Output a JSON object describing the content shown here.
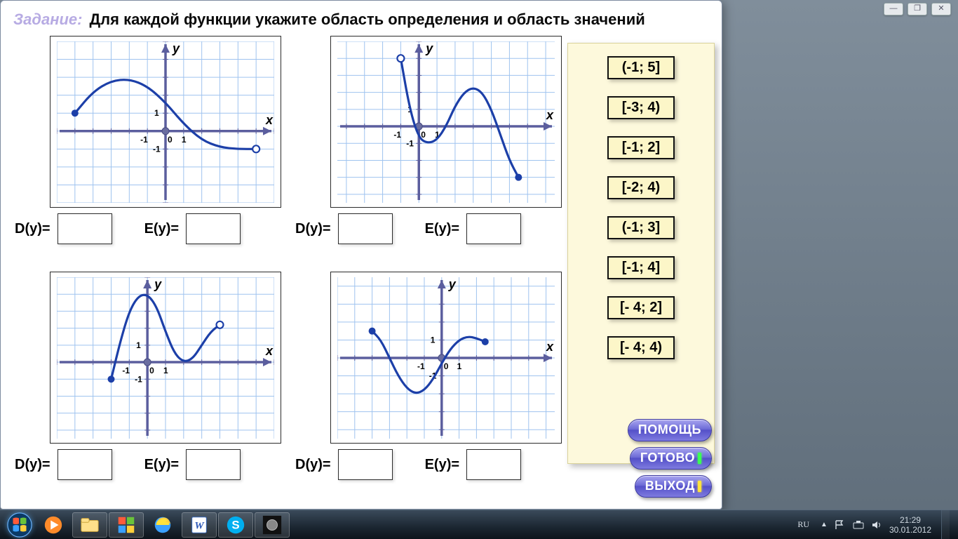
{
  "window": {
    "minimize": "—",
    "maximize": "❐",
    "close": "✕"
  },
  "header": {
    "label": "Задание:",
    "text": "Для каждой функции укажите область определения и область значений"
  },
  "io": {
    "domain": "D(y)=",
    "range": "E(y)="
  },
  "answers": [
    "(-1; 5]",
    "[-3; 4)",
    "[-1; 2]",
    "[-2; 4)",
    "(-1; 3]",
    "[-1; 4]",
    "[- 4; 2]",
    "[- 4; 4)"
  ],
  "buttons": {
    "help": "ПОМОЩЬ",
    "done": "ГОТОВО",
    "exit": "ВЫХОД"
  },
  "axis": {
    "x": "x",
    "y": "y",
    "tickNeg": "-1",
    "tickPos": "1",
    "origin": "0"
  },
  "chart_data": [
    {
      "type": "line",
      "xlabel": "x",
      "ylabel": "y",
      "xlim": [
        -6,
        6
      ],
      "ylim": [
        -4,
        5
      ],
      "curve": [
        [
          -5,
          1
        ],
        [
          -4,
          2.2
        ],
        [
          -3,
          2.8
        ],
        [
          -2,
          2.9
        ],
        [
          -1,
          2.5
        ],
        [
          0,
          1.6
        ],
        [
          1,
          0.4
        ],
        [
          2,
          -0.5
        ],
        [
          3,
          -0.9
        ],
        [
          4,
          -1
        ],
        [
          5,
          -1
        ]
      ],
      "endpoints": [
        {
          "x": -5,
          "y": 1,
          "open": false
        },
        {
          "x": 5,
          "y": -1,
          "open": true
        }
      ]
    },
    {
      "type": "line",
      "xlabel": "x",
      "ylabel": "y",
      "xlim": [
        -4.5,
        7.5
      ],
      "ylim": [
        -4.5,
        5
      ],
      "curve": [
        [
          -1,
          4
        ],
        [
          -0.5,
          1
        ],
        [
          0,
          -0.7
        ],
        [
          0.5,
          -1
        ],
        [
          1,
          -0.8
        ],
        [
          1.5,
          0
        ],
        [
          2,
          1.2
        ],
        [
          2.5,
          2
        ],
        [
          3,
          2.3
        ],
        [
          3.5,
          2
        ],
        [
          4,
          1
        ],
        [
          4.5,
          -0.5
        ],
        [
          5,
          -2
        ],
        [
          5.5,
          -3
        ]
      ],
      "endpoints": [
        {
          "x": -1,
          "y": 4,
          "open": true
        },
        {
          "x": 5.5,
          "y": -3,
          "open": false
        }
      ]
    },
    {
      "type": "line",
      "xlabel": "x",
      "ylabel": "y",
      "xlim": [
        -5,
        7
      ],
      "ylim": [
        -4.5,
        5
      ],
      "curve": [
        [
          -2,
          -1
        ],
        [
          -1.5,
          1.2
        ],
        [
          -1,
          3
        ],
        [
          -0.5,
          3.9
        ],
        [
          0,
          4
        ],
        [
          0.5,
          3.3
        ],
        [
          1,
          1.8
        ],
        [
          1.5,
          0.5
        ],
        [
          2,
          0
        ],
        [
          2.5,
          0.2
        ],
        [
          3,
          1
        ],
        [
          3.5,
          1.8
        ],
        [
          4,
          2.2
        ]
      ],
      "endpoints": [
        {
          "x": -2,
          "y": -1,
          "open": false
        },
        {
          "x": 4,
          "y": 2.2,
          "open": true
        }
      ]
    },
    {
      "type": "line",
      "xlabel": "x",
      "ylabel": "y",
      "xlim": [
        -6,
        6.5
      ],
      "ylim": [
        -4.5,
        4.5
      ],
      "curve": [
        [
          -4,
          1.5
        ],
        [
          -3.5,
          1
        ],
        [
          -3,
          0
        ],
        [
          -2.5,
          -1
        ],
        [
          -2,
          -1.7
        ],
        [
          -1.5,
          -2
        ],
        [
          -1,
          -1.8
        ],
        [
          -0.5,
          -1.2
        ],
        [
          0,
          -0.3
        ],
        [
          0.5,
          0.5
        ],
        [
          1,
          1
        ],
        [
          1.5,
          1.2
        ],
        [
          2,
          1.1
        ],
        [
          2.5,
          0.9
        ]
      ],
      "endpoints": [
        {
          "x": -4,
          "y": 1.5,
          "open": false
        },
        {
          "x": 2.5,
          "y": 0.9,
          "open": false
        }
      ]
    }
  ],
  "taskbar": {
    "lang": "RU",
    "time": "21:29",
    "date": "30.01.2012"
  }
}
